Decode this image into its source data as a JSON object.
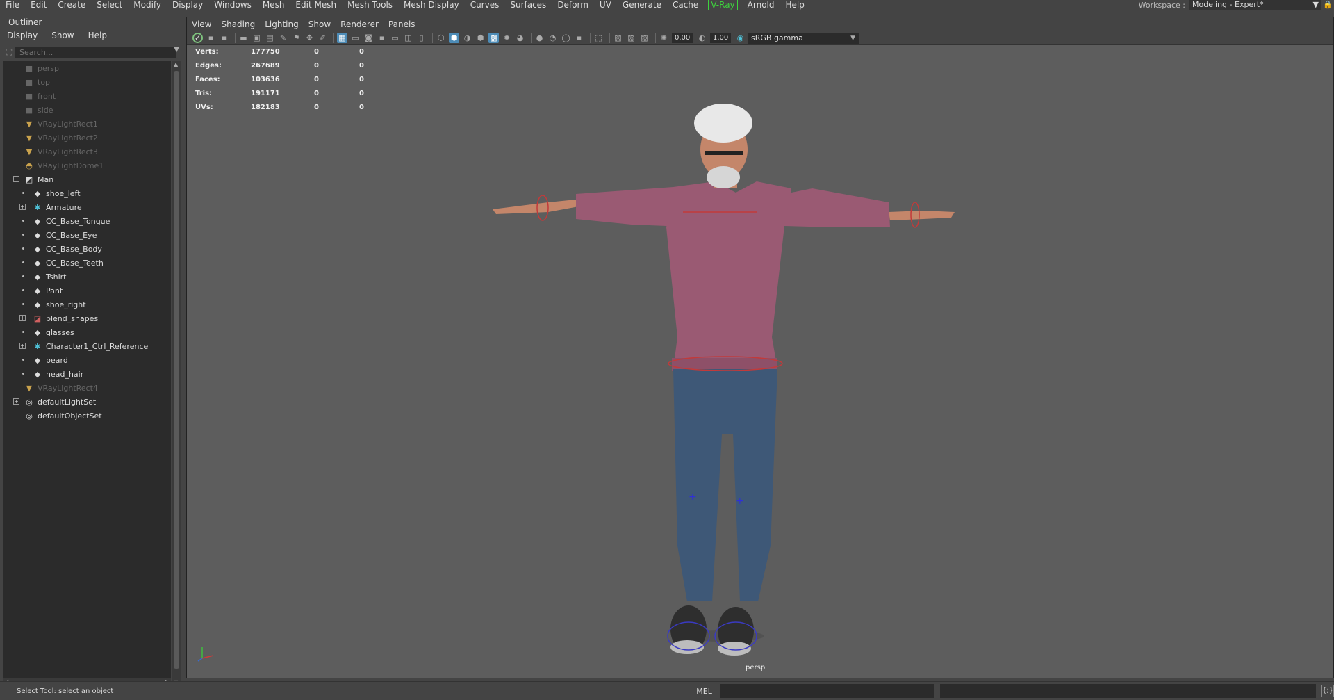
{
  "menubar": {
    "items": [
      "File",
      "Edit",
      "Create",
      "Select",
      "Modify",
      "Display",
      "Windows",
      "Mesh",
      "Edit Mesh",
      "Mesh Tools",
      "Mesh Display",
      "Curves",
      "Surfaces",
      "Deform",
      "UV",
      "Generate",
      "Cache",
      "V-Ray",
      "Arnold",
      "Help"
    ],
    "workspace_label": "Workspace :",
    "workspace_value": "Modeling - Expert*"
  },
  "outliner": {
    "title": "Outliner",
    "menu": [
      "Display",
      "Show",
      "Help"
    ],
    "search_placeholder": "Search...",
    "nodes": [
      {
        "label": "persp",
        "icon": "camera-icon",
        "dim": true
      },
      {
        "label": "top",
        "icon": "camera-icon",
        "dim": true
      },
      {
        "label": "front",
        "icon": "camera-icon",
        "dim": true
      },
      {
        "label": "side",
        "icon": "camera-icon",
        "dim": true
      },
      {
        "label": "VRayLightRect1",
        "icon": "rect-light-icon",
        "dim": true
      },
      {
        "label": "VRayLightRect2",
        "icon": "rect-light-icon",
        "dim": true
      },
      {
        "label": "VRayLightRect3",
        "icon": "rect-light-icon",
        "dim": true
      },
      {
        "label": "VRayLightDome1",
        "icon": "dome-light-icon",
        "dim": true
      },
      {
        "label": "Man",
        "icon": "group-icon",
        "dim": false
      },
      {
        "label": "shoe_left",
        "icon": "mesh-icon",
        "dim": false
      },
      {
        "label": "Armature",
        "icon": "joint-icon",
        "dim": false
      },
      {
        "label": "CC_Base_Tongue",
        "icon": "mesh-icon",
        "dim": false
      },
      {
        "label": "CC_Base_Eye",
        "icon": "mesh-icon",
        "dim": false
      },
      {
        "label": "CC_Base_Body",
        "icon": "mesh-icon",
        "dim": false
      },
      {
        "label": "CC_Base_Teeth",
        "icon": "mesh-icon",
        "dim": false
      },
      {
        "label": "Tshirt",
        "icon": "mesh-icon",
        "dim": false
      },
      {
        "label": "Pant",
        "icon": "mesh-icon",
        "dim": false
      },
      {
        "label": "shoe_right",
        "icon": "mesh-icon",
        "dim": false
      },
      {
        "label": "blend_shapes",
        "icon": "blendshape-icon",
        "dim": false
      },
      {
        "label": "glasses",
        "icon": "mesh-icon",
        "dim": false
      },
      {
        "label": "Character1_Ctrl_Reference",
        "icon": "joint-icon",
        "dim": false
      },
      {
        "label": "beard",
        "icon": "mesh-icon",
        "dim": false
      },
      {
        "label": "head_hair",
        "icon": "mesh-icon",
        "dim": false
      },
      {
        "label": "VRayLightRect4",
        "icon": "rect-light-icon",
        "dim": true
      },
      {
        "label": "defaultLightSet",
        "icon": "set-icon",
        "dim": false
      },
      {
        "label": "defaultObjectSet",
        "icon": "set-icon",
        "dim": false
      }
    ]
  },
  "viewport": {
    "menu": [
      "View",
      "Shading",
      "Lighting",
      "Show",
      "Renderer",
      "Panels"
    ],
    "exposure": "0.00",
    "gamma": "1.00",
    "color_space": "sRGB gamma",
    "camera": "persp",
    "hud": {
      "rows": [
        {
          "label": "Verts:",
          "v1": "177750",
          "v2": "0",
          "v3": "0"
        },
        {
          "label": "Edges:",
          "v1": "267689",
          "v2": "0",
          "v3": "0"
        },
        {
          "label": "Faces:",
          "v1": "103636",
          "v2": "0",
          "v3": "0"
        },
        {
          "label": "Tris:",
          "v1": "191171",
          "v2": "0",
          "v3": "0"
        },
        {
          "label": "UVs:",
          "v1": "182183",
          "v2": "0",
          "v3": "0"
        }
      ]
    }
  },
  "status": {
    "message": "Select Tool: select an object",
    "mel_label": "MEL"
  },
  "colors": {
    "vray_menu": "#3ed23e",
    "shirt": "#9a5a73",
    "jeans": "#3e5877",
    "skin": "#c4866a",
    "viewport_bg": "#5d5d5d"
  }
}
